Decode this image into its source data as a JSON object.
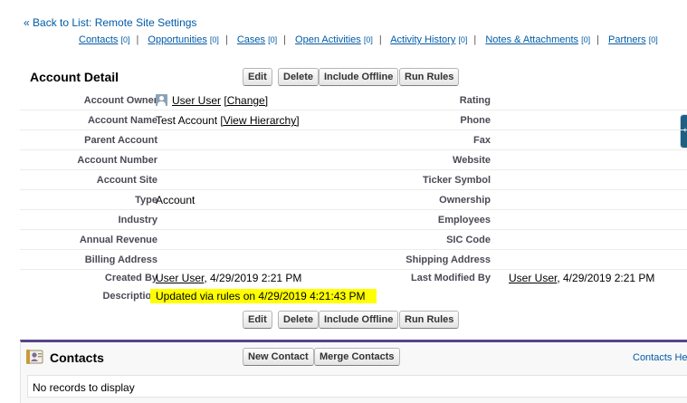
{
  "back_link": {
    "prefix": "« ",
    "label": "Back to List: Remote Site Settings"
  },
  "related_links": [
    {
      "label": "Contacts",
      "count": "[0]"
    },
    {
      "label": "Opportunities",
      "count": "[0]"
    },
    {
      "label": "Cases",
      "count": "[0]"
    },
    {
      "label": "Open Activities",
      "count": "[0]"
    },
    {
      "label": "Activity History",
      "count": "[0]"
    },
    {
      "label": "Notes & Attachments",
      "count": "[0]"
    },
    {
      "label": "Partners",
      "count": "[0]"
    }
  ],
  "separator": "|",
  "detail": {
    "title": "Account Detail",
    "buttons": {
      "edit": "Edit",
      "delete": "Delete",
      "include_offline": "Include Offline",
      "run_rules": "Run Rules"
    },
    "fields": {
      "account_owner": {
        "label": "Account Owner",
        "value": "User User",
        "action": "[Change]"
      },
      "rating": {
        "label": "Rating"
      },
      "account_name": {
        "label": "Account Name",
        "value": "Test Account",
        "action": "[View Hierarchy]"
      },
      "phone": {
        "label": "Phone"
      },
      "parent_account": {
        "label": "Parent Account"
      },
      "fax": {
        "label": "Fax"
      },
      "account_number": {
        "label": "Account Number"
      },
      "website": {
        "label": "Website"
      },
      "account_site": {
        "label": "Account Site"
      },
      "ticker_symbol": {
        "label": "Ticker Symbol"
      },
      "type": {
        "label": "Type",
        "value": "Account"
      },
      "ownership": {
        "label": "Ownership"
      },
      "industry": {
        "label": "Industry"
      },
      "employees": {
        "label": "Employees"
      },
      "annual_revenue": {
        "label": "Annual Revenue"
      },
      "sic_code": {
        "label": "SIC Code"
      },
      "billing_address": {
        "label": "Billing Address"
      },
      "shipping_address": {
        "label": "Shipping Address"
      },
      "created_by": {
        "label": "Created By",
        "user": "User User",
        "date": ", 4/29/2019 2:21 PM"
      },
      "last_modified_by": {
        "label": "Last Modified By",
        "user": "User User",
        "date": ", 4/29/2019 2:21 PM"
      },
      "description": {
        "label": "Description",
        "value": "Updated via rules on 4/29/2019 4:21:43 PM"
      }
    }
  },
  "contacts": {
    "title": "Contacts",
    "new_button": "New Contact",
    "merge_button": "Merge Contacts",
    "help": "Contacts Help",
    "empty": "No records to display"
  },
  "side_tab_glyph": "‹",
  "colors": {
    "link": "#015ba7",
    "highlight": "#ffff00",
    "contacts_accent": "#56458c"
  }
}
